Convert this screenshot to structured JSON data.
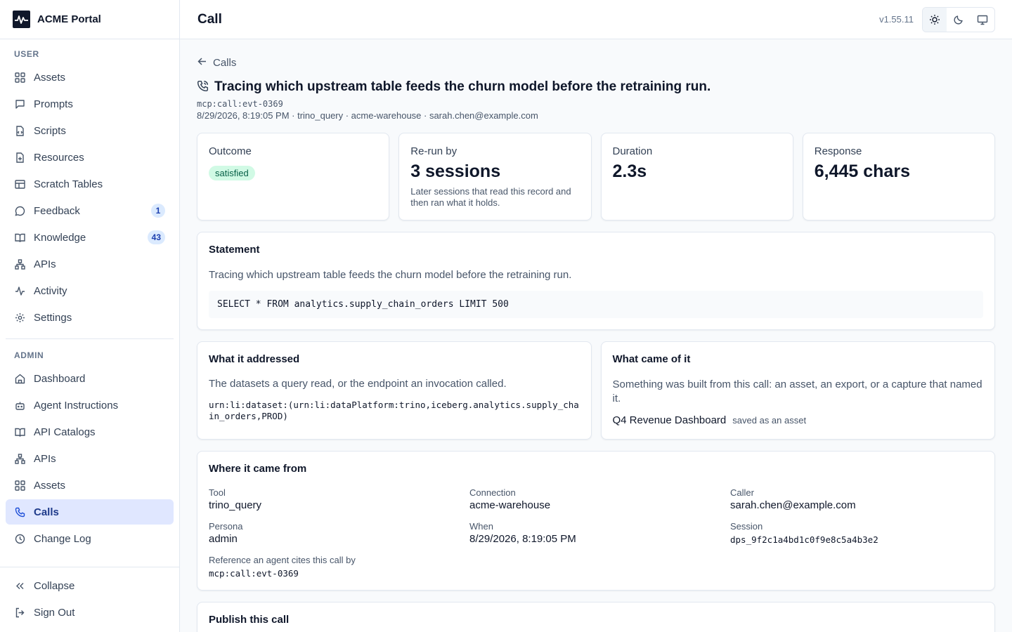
{
  "brand": {
    "name": "ACME Portal",
    "logo_icon": "pulse-logo-icon"
  },
  "sidebar": {
    "user_section": "USER",
    "user_items": [
      {
        "label": "Assets",
        "icon": "grid-icon"
      },
      {
        "label": "Prompts",
        "icon": "message-square-icon"
      },
      {
        "label": "Scripts",
        "icon": "file-code-icon"
      },
      {
        "label": "Resources",
        "icon": "file-plus-icon"
      },
      {
        "label": "Scratch Tables",
        "icon": "table-icon"
      },
      {
        "label": "Feedback",
        "icon": "message-circle-icon",
        "badge": "1"
      },
      {
        "label": "Knowledge",
        "icon": "book-open-icon",
        "badge": "43"
      },
      {
        "label": "APIs",
        "icon": "network-icon"
      },
      {
        "label": "Activity",
        "icon": "activity-icon"
      },
      {
        "label": "Settings",
        "icon": "gear-icon"
      }
    ],
    "admin_section": "ADMIN",
    "admin_items": [
      {
        "label": "Dashboard",
        "icon": "home-icon"
      },
      {
        "label": "Agent Instructions",
        "icon": "bot-icon"
      },
      {
        "label": "API Catalogs",
        "icon": "book-open-icon"
      },
      {
        "label": "APIs",
        "icon": "network-icon"
      },
      {
        "label": "Assets",
        "icon": "grid-icon"
      },
      {
        "label": "Calls",
        "icon": "phone-icon",
        "active": true
      },
      {
        "label": "Change Log",
        "icon": "clock-icon"
      }
    ],
    "footer": {
      "collapse": "Collapse",
      "sign_out": "Sign Out"
    }
  },
  "header": {
    "title": "Call",
    "version": "v1.55.11",
    "theme_options": [
      "light-theme-icon",
      "dark-theme-icon",
      "system-theme-icon"
    ]
  },
  "call": {
    "back_label": "Calls",
    "title": "Tracing which upstream table feeds the churn model before the retraining run.",
    "id": "mcp:call:evt-0369",
    "meta": "8/29/2026, 8:19:05 PM · trino_query · acme-warehouse · sarah.chen@example.com"
  },
  "stats": {
    "outcome": {
      "label": "Outcome",
      "value": "satisfied"
    },
    "rerun": {
      "label": "Re-run by",
      "value": "3 sessions",
      "sub": "Later sessions that read this record and then ran what it holds."
    },
    "duration": {
      "label": "Duration",
      "value": "2.3s"
    },
    "response": {
      "label": "Response",
      "value": "6,445 chars"
    }
  },
  "statement": {
    "heading": "Statement",
    "text": "Tracing which upstream table feeds the churn model before the retraining run.",
    "sql": "SELECT * FROM analytics.supply_chain_orders LIMIT 500"
  },
  "addressed": {
    "heading": "What it addressed",
    "desc": "The datasets a query read, or the endpoint an invocation called.",
    "urn": "urn:li:dataset:(urn:li:dataPlatform:trino,iceberg.analytics.supply_chain_orders,PROD)"
  },
  "outcome_result": {
    "heading": "What came of it",
    "desc": "Something was built from this call: an asset, an export, or a capture that named it.",
    "artifact_name": "Q4 Revenue Dashboard",
    "artifact_note": "saved as an asset"
  },
  "origin": {
    "heading": "Where it came from",
    "tool_label": "Tool",
    "tool": "trino_query",
    "connection_label": "Connection",
    "connection": "acme-warehouse",
    "caller_label": "Caller",
    "caller": "sarah.chen@example.com",
    "persona_label": "Persona",
    "persona": "admin",
    "when_label": "When",
    "when": "8/29/2026, 8:19:05 PM",
    "session_label": "Session",
    "session": "dps_9f2c1a4bd1c0f9e8c5a4b3e2",
    "ref_label": "Reference an agent cites this call by",
    "ref": "mcp:call:evt-0369"
  },
  "publish": {
    "heading": "Publish this call"
  },
  "colors": {
    "accent": "#1d4ed8",
    "active_bg": "#e0e7ff",
    "success_bg": "#d1fae5",
    "success_text": "#065f46"
  }
}
